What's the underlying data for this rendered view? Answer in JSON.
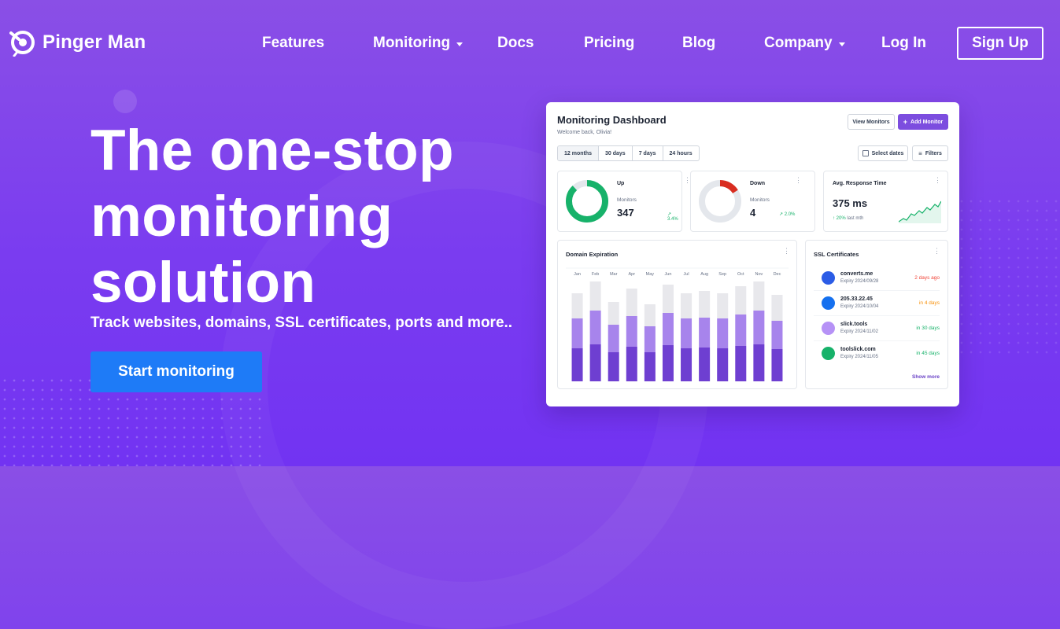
{
  "brand": {
    "name": "Pinger Man"
  },
  "nav": {
    "items": [
      {
        "label": "Features",
        "dropdown": false
      },
      {
        "label": "Monitoring",
        "dropdown": true
      },
      {
        "label": "Docs",
        "dropdown": false
      },
      {
        "label": "Pricing",
        "dropdown": false
      },
      {
        "label": "Blog",
        "dropdown": false
      },
      {
        "label": "Company",
        "dropdown": true
      },
      {
        "label": "Log In",
        "dropdown": false
      }
    ],
    "signup_label": "Sign Up"
  },
  "hero": {
    "title_lines": [
      "The one-stop",
      "monitoring",
      "solution"
    ],
    "subtitle": "Track websites, domains, SSL certificates, ports and more..",
    "cta_label": "Start monitoring"
  },
  "dashboard": {
    "title": "Monitoring Dashboard",
    "welcome": "Welcome back, Olivia!",
    "view_monitors": "View Monitors",
    "add_monitor": "Add Monitor",
    "ranges": [
      "12 months",
      "30 days",
      "7 days",
      "24 hours"
    ],
    "active_range": "12 months",
    "select_dates": "Select dates",
    "filters": "Filters",
    "up": {
      "label": "Up",
      "sub": "Monitors",
      "value": "347",
      "change": "3.4%",
      "ring_fraction": 0.88,
      "color": "#17b26a"
    },
    "down": {
      "label": "Down",
      "sub": "Monitors",
      "value": "4",
      "change": "2.0%",
      "ring_fraction": 0.16,
      "color": "#d92d20"
    },
    "response": {
      "label": "Avg. Response Time",
      "value": "375 ms",
      "change": "20%",
      "period": "last mth"
    },
    "domain_expiration": {
      "title": "Domain Expiration"
    },
    "ssl": {
      "title": "SSL Certificates",
      "rows": [
        {
          "name": "converts.me",
          "expiry": "Expiry 2024/09/28",
          "days": "2 days ago",
          "status": "red"
        },
        {
          "name": "205.33.22.45",
          "expiry": "Expiry 2024/10/04",
          "days": "in 4 days",
          "status": "orange"
        },
        {
          "name": "slick.tools",
          "expiry": "Expiry 2024/11/02",
          "days": "in 30 days",
          "status": "green"
        },
        {
          "name": "toolslick.com",
          "expiry": "Expiry 2024/11/05",
          "days": "in 45 days",
          "status": "green"
        }
      ],
      "show_more": "Show more"
    }
  },
  "chart_data": {
    "type": "bar",
    "title": "Domain Expiration",
    "categories": [
      "Jan",
      "Feb",
      "Mar",
      "Apr",
      "May",
      "Jun",
      "Jul",
      "Aug",
      "Sep",
      "Oct",
      "Nov",
      "Dec"
    ],
    "stacked": true,
    "series": [
      {
        "values": [
          42,
          47,
          37,
          44,
          37,
          46,
          42,
          43,
          42,
          45,
          47,
          41
        ],
        "color": "#6e3fd1"
      },
      {
        "values": [
          38,
          43,
          35,
          39,
          33,
          41,
          38,
          38,
          38,
          40,
          43,
          36
        ],
        "color": "#a784ec"
      },
      {
        "values": [
          32,
          37,
          29,
          35,
          28,
          36,
          32,
          34,
          32,
          36,
          37,
          33
        ],
        "color": "#e8e8ec"
      }
    ],
    "ylim": [
      0,
      125
    ],
    "grid": false,
    "legend": "none"
  }
}
